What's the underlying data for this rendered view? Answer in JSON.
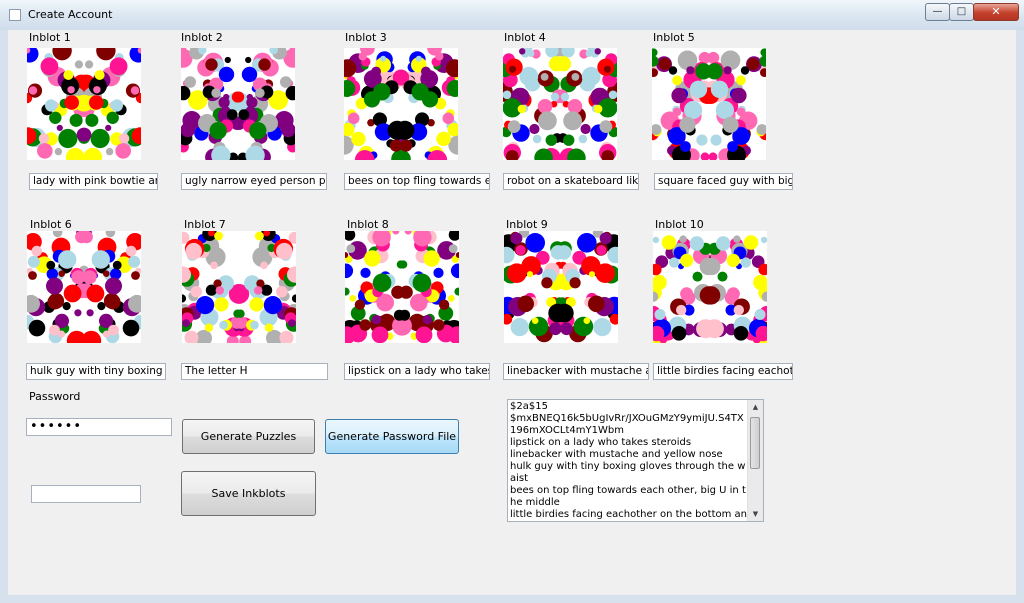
{
  "window": {
    "title": "Create Account",
    "controls": {
      "minimize": "—",
      "maximize": "□",
      "close": "✕"
    }
  },
  "inkblots": [
    {
      "label": "Inblot 1",
      "description": "lady with pink bowtie and pur"
    },
    {
      "label": "Inblot 2",
      "description": "ugly narrow eyed person puckerir"
    },
    {
      "label": "Inblot 3",
      "description": "bees on top fling towards each ot"
    },
    {
      "label": "Inblot 4",
      "description": "robot on a skateboard like thin"
    },
    {
      "label": "Inblot 5",
      "description": "square faced guy with big nose"
    },
    {
      "label": "Inblot 6",
      "description": "hulk guy with tiny boxing gloves"
    },
    {
      "label": "Inblot 7",
      "description": "The letter H"
    },
    {
      "label": "Inblot 8",
      "description": "lipstick on a lady who takes sterc"
    },
    {
      "label": "Inblot 9",
      "description": "linebacker with mustache and ye"
    },
    {
      "label": "Inblot 10",
      "description": "little birdies facing eachother on"
    }
  ],
  "form": {
    "password_label": "Password",
    "password_value": "••••••",
    "extra_field_value": "",
    "generate_puzzles_label": "Generate Puzzles",
    "generate_password_file_label": "Generate Password File",
    "save_inkblots_label": "Save Inkblots"
  },
  "output": {
    "lines": [
      "$2a$15",
      "$mxBNEQ16k5bUgIvRr/JXOuGMzY9ymiJU.S4TX196mXOCLt4mY1Wbm",
      "lipstick on a lady who takes steroids",
      "linebacker with mustache and yellow nose",
      "hulk guy with tiny boxing gloves through the waist",
      "bees on top fling towards each other, big U in the middle",
      "little birdies facing eachother on the bottom and little bees flying away from eachother on top"
    ]
  },
  "colors": {
    "palette": [
      "#ff0000",
      "#0000ff",
      "#ffff00",
      "#008000",
      "#800080",
      "#000000",
      "#ff69b4",
      "#ffc0cb",
      "#add8e6",
      "#800000",
      "#ff1493",
      "#b0b0b0"
    ]
  }
}
